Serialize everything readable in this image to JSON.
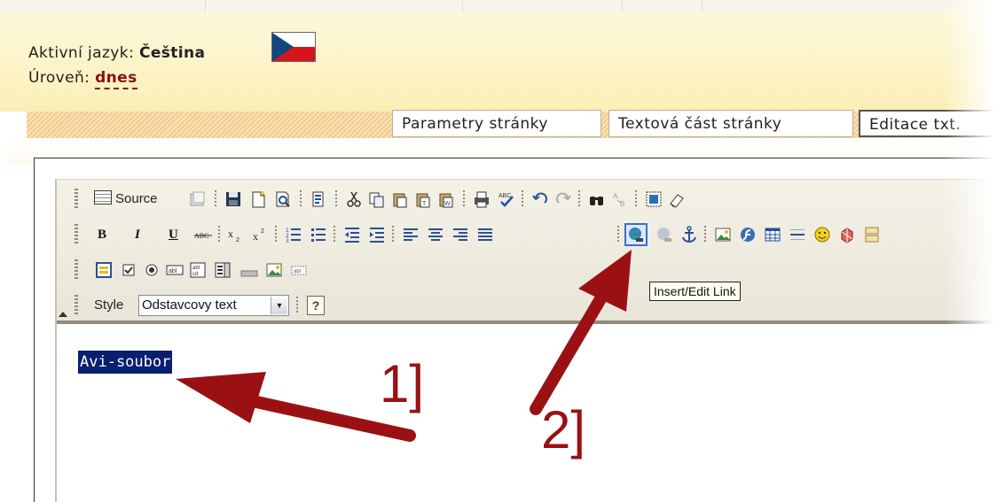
{
  "header": {
    "language_label": "Aktivní jazyk:",
    "language_value": "Čeština",
    "level_label": "Úroveň:",
    "level_value": "dnes"
  },
  "tabs": [
    {
      "label": "Parametry stránky"
    },
    {
      "label": "Textová část stránky"
    },
    {
      "label": "Editace txt."
    }
  ],
  "toolbar": {
    "source_label": "Source",
    "bold_label": "B",
    "italic_label": "I",
    "underline_label": "U",
    "style_label": "Style",
    "style_value": "Odstavcovy text",
    "help_label": "?"
  },
  "tooltip": {
    "text": "Insert/Edit Link"
  },
  "editor": {
    "selected_text": "Avi-soubor"
  },
  "annotations": {
    "step1": "1]",
    "step2": "2]"
  },
  "colors": {
    "header_bg": "#fbefb6",
    "accent_red": "#9b1113",
    "level_value": "#8b0e14",
    "selection_bg": "#0a1f6e"
  }
}
